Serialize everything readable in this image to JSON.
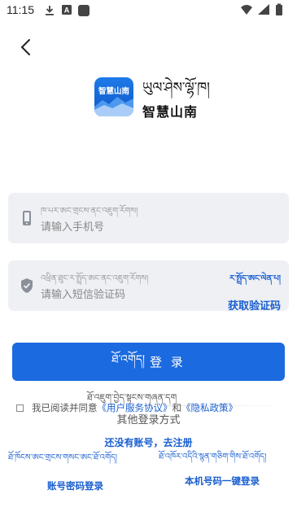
{
  "status_bar": {
    "time": "11:15",
    "icons": [
      "download-icon",
      "notification-a-icon",
      "app-square-icon",
      "wifi-icon",
      "signal-icon",
      "battery-icon"
    ]
  },
  "header": {
    "back_icon": "chevron-left-icon"
  },
  "app": {
    "logo_text": "智慧山南",
    "name_tibetan": "ཡུལ་ཤེས་ལྷོ་ཁ།",
    "name_chinese": "智慧山南",
    "brand_color": "#1b6ae0"
  },
  "phone_field": {
    "label_tibetan": "ཁ་པར་ཨང་གྲངས་ནང་འཇུག་རོགས།",
    "placeholder": "请输入手机号",
    "value": "",
    "icon": "phone-icon"
  },
  "code_field": {
    "label_tibetan": "འཕྲིན་ཐུང་ར་སྤྲོད་ཨང་ནང་འཇུག་རོགས།",
    "placeholder": "请输入短信验证码",
    "value": "",
    "icon": "shield-check-icon",
    "get_code_tibetan": "ར་སྤྲོད་ཨང་ལེན་པ།",
    "get_code_label": "获取验证码"
  },
  "login_button": {
    "label_tibetan": "ཐོ་འགོད།",
    "label": "登 录"
  },
  "agreement": {
    "tibetan": "ཐོ་འཇུག་བྱེད་སྟངས་གཞན་དག",
    "prefix": "我已阅读并同意",
    "link1": "《用户服务协议》",
    "and": "和",
    "link2": "《隐私政策》"
  },
  "other_login": {
    "title": "其他登录方式",
    "register": "还没有账号，去注册",
    "password_login_tibetan": "ཐོ་ཁོངས་ཨང་གྲངས་གསང་ཨང་ཐོ་འགོད།",
    "password_login": "账号密码登录",
    "onekey_login_tibetan": "ཐོ་འཁོར་འདིའི་སྙན་གཅིག་གིས་ཐོ་འགོད།",
    "onekey_login": "本机号码一键登录"
  }
}
